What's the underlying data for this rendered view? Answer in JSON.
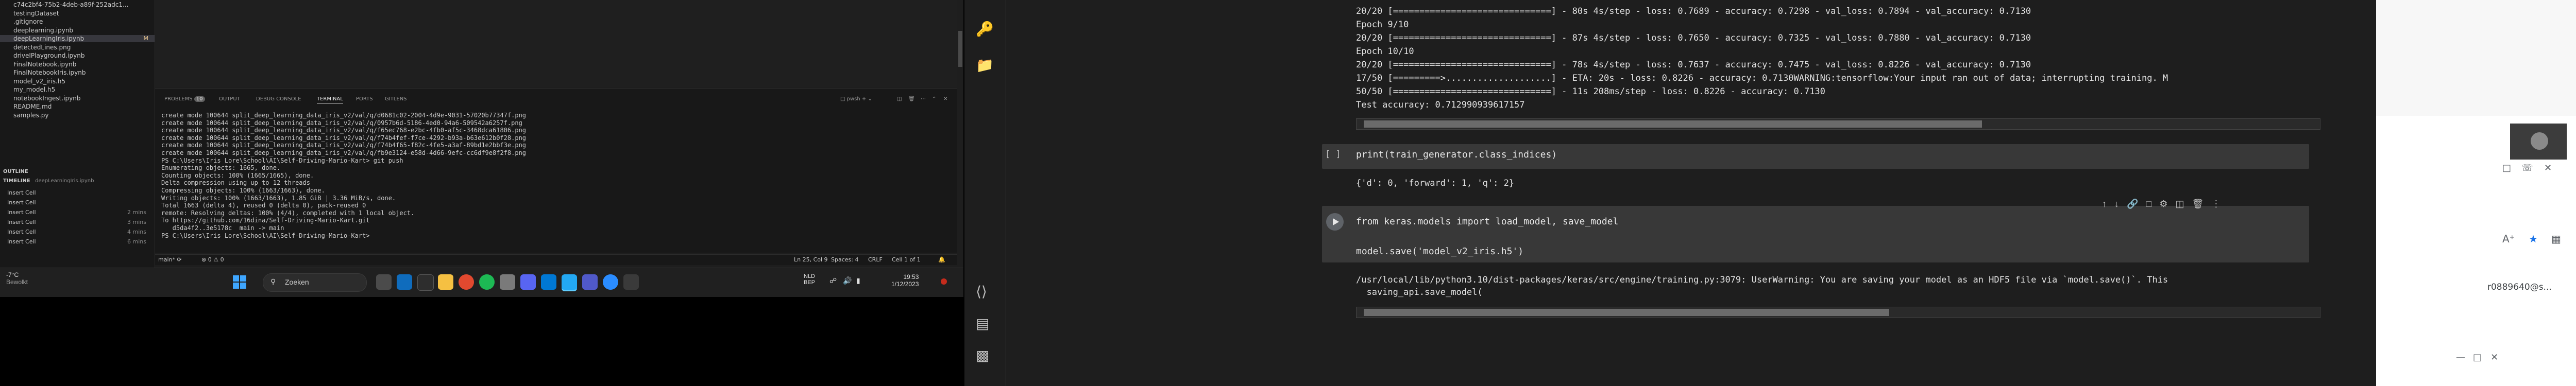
{
  "explorer": {
    "items": [
      {
        "label": "c74c2bf4-75b2-4deb-a89f-252adc1...",
        "badge": ""
      },
      {
        "label": "testingDataset",
        "badge": ""
      },
      {
        "label": ".gitignore",
        "badge": ""
      },
      {
        "label": "deeplearning.ipynb",
        "badge": ""
      },
      {
        "label": "deepLearningIris.ipynb",
        "badge": "M"
      },
      {
        "label": "detectedLines.png",
        "badge": ""
      },
      {
        "label": "driveIPlayground.ipynb",
        "badge": ""
      },
      {
        "label": "FinalNotebook.ipynb",
        "badge": ""
      },
      {
        "label": "FinalNotebookIris.ipynb",
        "badge": ""
      },
      {
        "label": "model_v2_iris.h5",
        "badge": ""
      },
      {
        "label": "my_model.h5",
        "badge": ""
      },
      {
        "label": "notebookIngest.ipynb",
        "badge": ""
      },
      {
        "label": "README.md",
        "badge": ""
      },
      {
        "label": "samples.py",
        "badge": ""
      }
    ],
    "outline_label": "OUTLINE",
    "timeline_label": "TIMELINE",
    "timeline_file": "deepLearningIris.ipynb",
    "timeline": [
      {
        "label": "Insert Cell",
        "time": ""
      },
      {
        "label": "Insert Cell",
        "time": ""
      },
      {
        "label": "Insert Cell",
        "time": "2 mins"
      },
      {
        "label": "Insert Cell",
        "time": "3 mins"
      },
      {
        "label": "Insert Cell",
        "time": "4 mins"
      },
      {
        "label": "Insert Cell",
        "time": "6 mins"
      }
    ]
  },
  "panel": {
    "tabs": [
      "PROBLEMS",
      "OUTPUT",
      "DEBUG CONSOLE",
      "TERMINAL",
      "PORTS",
      "GITLENS"
    ],
    "problems_count": "10",
    "shell": "pwsh",
    "terminal_lines": [
      "create mode 100644 split_deep_learning_data_iris_v2/val/q/d0681c02-2004-4d9e-9031-57020b77347f.png",
      "create mode 100644 split_deep_learning_data_iris_v2/val/q/0957b6d-5186-4ed0-94a6-509542a6257f.png",
      "create mode 100644 split_deep_learning_data_iris_v2/val/q/f65ec768-e2bc-4fb0-af5c-3468dca61806.png",
      "create mode 100644 split_deep_learning_data_iris_v2/val/q/f74b4fef-f7ce-4292-b93a-b63e612b0f28.png",
      "create mode 100644 split_deep_learning_data_iris_v2/val/q/f74b4f65-f82c-4fe5-a3af-89bd1e2bbf3e.png",
      "create mode 100644 split_deep_learning_data_iris_v2/val/q/fb9e3124-e58d-4d66-9efc-cc6df9e8f2f8.png",
      "PS C:\\Users\\Iris Lore\\School\\AI\\Self-Driving-Mario-Kart> git push",
      "Enumerating objects: 1665, done.",
      "Counting objects: 100% (1665/1665), done.",
      "Delta compression using up to 12 threads",
      "Compressing objects: 100% (1663/1663), done.",
      "Writing objects: 100% (1663/1663), 1.85 GiB | 3.36 MiB/s, done.",
      "Total 1663 (delta 4), reused 0 (delta 0), pack-reused 0",
      "remote: Resolving deltas: 100% (4/4), completed with 1 local object.",
      "To https://github.com/16dina/Self-Driving-Mario-Kart.git",
      "   d5da4f2..3e5178c  main -> main",
      "PS C:\\Users\\Iris Lore\\School\\AI\\Self-Driving-Mario-Kart> "
    ]
  },
  "statusbar": {
    "branch": "main*",
    "sync": "⟳",
    "errors": "⊗ 0 ⚠ 0",
    "position": "Ln 25, Col 9",
    "spaces": "Spaces: 4",
    "encoding": "CRLF",
    "cell": "Cell 1 of 1"
  },
  "taskbar": {
    "weather_temp": "-7°C",
    "weather_desc": "Bewolkt",
    "search_placeholder": "Zoeken",
    "lang_top": "NLD",
    "lang_bottom": "BEP",
    "time": "19:53",
    "date": "1/12/2023"
  },
  "colab": {
    "output1": [
      "20/20 [==============================] - 80s 4s/step - loss: 0.7689 - accuracy: 0.7298 - val_loss: 0.7894 - val_accuracy: 0.7130",
      "Epoch 9/10",
      "20/20 [==============================] - 87s 4s/step - loss: 0.7650 - accuracy: 0.7325 - val_loss: 0.7880 - val_accuracy: 0.7130",
      "Epoch 10/10",
      "20/20 [==============================] - 78s 4s/step - loss: 0.7637 - accuracy: 0.7475 - val_loss: 0.8226 - val_accuracy: 0.7130",
      "17/50 [=========>....................] - ETA: 20s - loss: 0.8226 - accuracy: 0.7130WARNING:tensorflow:Your input ran out of data; interrupting training. M",
      "50/50 [==============================] - 11s 208ms/step - loss: 0.8226 - accuracy: 0.7130",
      "Test accuracy: 0.712990939617157"
    ],
    "cell2_marker": "[ ]",
    "cell2_code": "print(train_generator.class_indices)",
    "cell2_output": "{'d': 0, 'forward': 1, 'q': 2}",
    "cell3_code_line1": "from keras.models import load_model, save_model",
    "cell3_code_line2": "model.save('model_v2_iris.h5')",
    "cell3_output_line1": "/usr/local/lib/python3.10/dist-packages/keras/src/engine/training.py:3079: UserWarning: You are saving your model as an HDF5 file via `model.save()`. This",
    "cell3_output_line2": "  saving_api.save_model("
  },
  "browser": {
    "user": "r0889640@s..."
  }
}
